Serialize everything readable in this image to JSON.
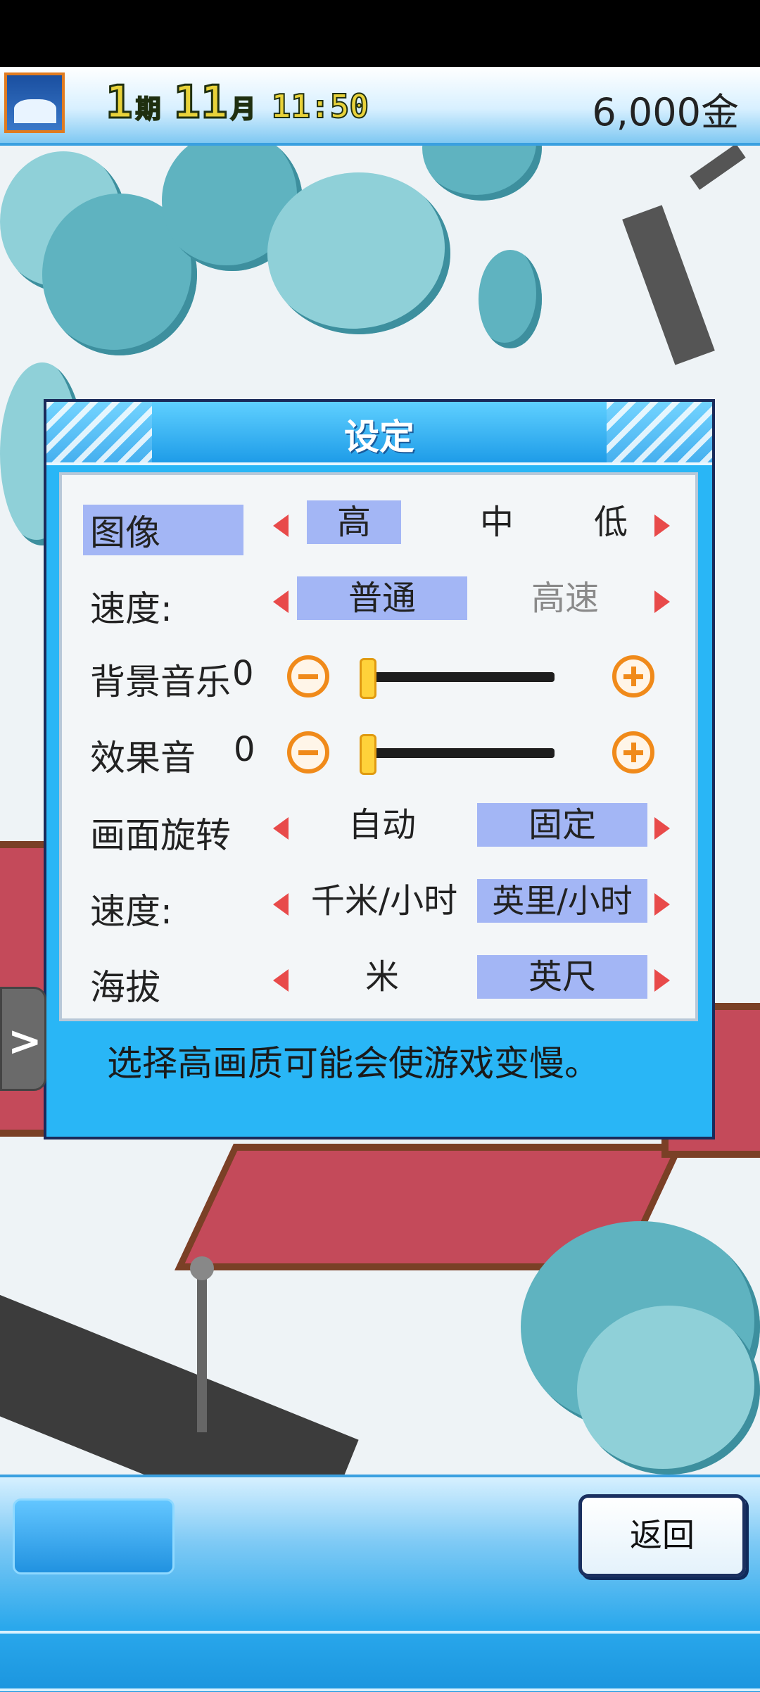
{
  "status_bar": {
    "period_number": "1",
    "period_unit": "期",
    "month_number": "11",
    "month_unit": "月",
    "time": "11:50",
    "money": "6,000金"
  },
  "dialog": {
    "title": "设定",
    "rows": {
      "graphics": {
        "label": "图像",
        "options": [
          "高",
          "中",
          "低"
        ],
        "selected": "高"
      },
      "speed": {
        "label": "速度:",
        "options": [
          "普通",
          "高速"
        ],
        "selected": "普通"
      },
      "bgm": {
        "label": "背景音乐",
        "value": "0"
      },
      "sfx": {
        "label": "效果音",
        "value": "0"
      },
      "rotation": {
        "label": "画面旋转",
        "options": [
          "自动",
          "固定"
        ],
        "selected": "固定"
      },
      "speed_unit": {
        "label": "速度:",
        "options": [
          "千米/小时",
          "英里/小时"
        ],
        "selected": "英里/小时"
      },
      "altitude": {
        "label": "海拔",
        "options": [
          "米",
          "英尺"
        ],
        "selected": "英尺"
      }
    },
    "hint": "选择高画质可能会使游戏变慢。"
  },
  "bottom": {
    "back_label": "返回"
  },
  "colors": {
    "dialog_bg": "#29b6f6",
    "selected_option": "#a3b6f5",
    "arrow": "#e84a4a",
    "slider_button": "#f08a1a"
  }
}
